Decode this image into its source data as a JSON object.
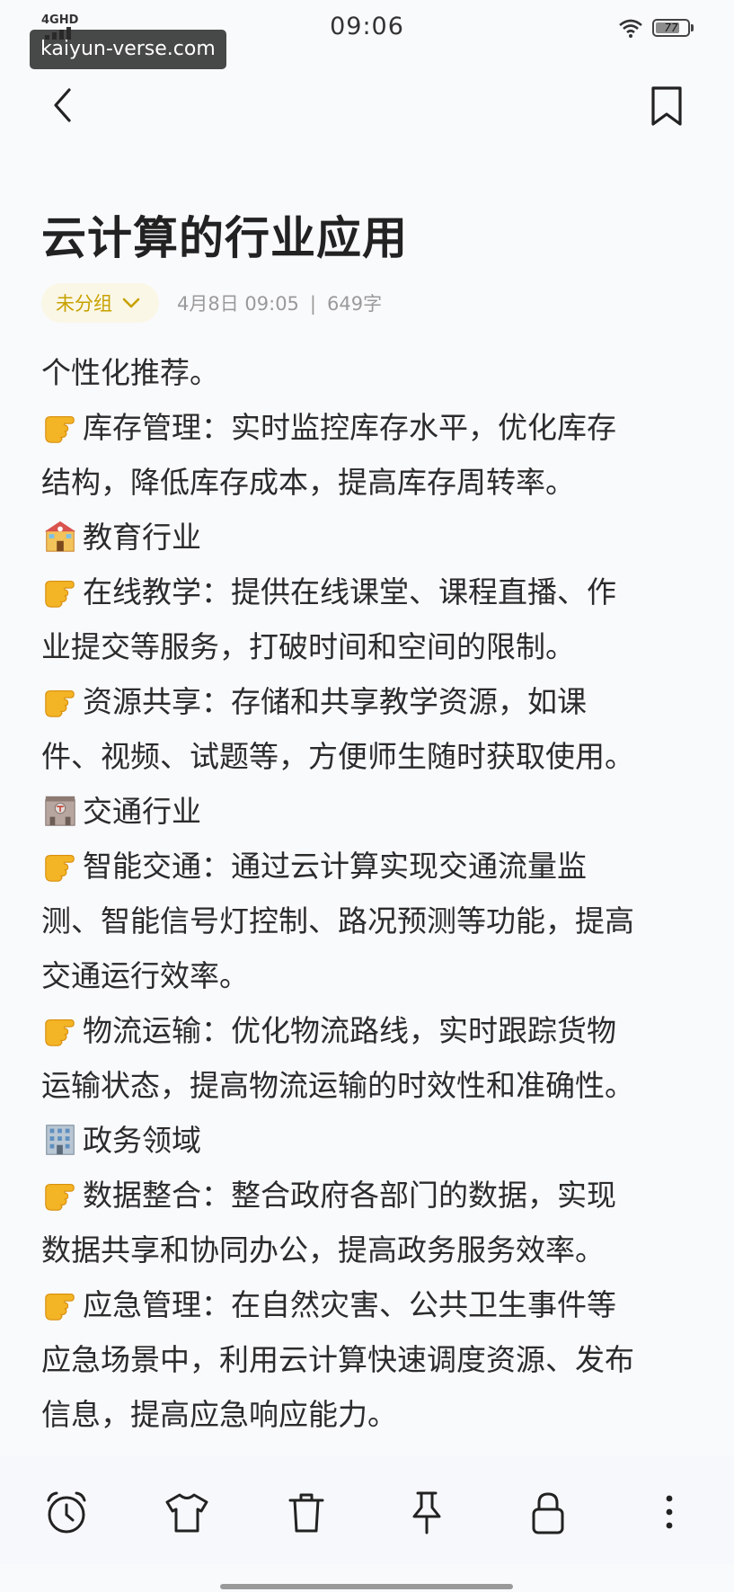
{
  "status_bar": {
    "network": "4GHD",
    "time": "09:06",
    "battery": "77",
    "battery_level": 0.77
  },
  "watermark": "kaiyun-verse.com",
  "nav": {
    "back_icon": "chevron-left-icon",
    "bookmark_icon": "bookmark-icon"
  },
  "note": {
    "title": "云计算的行业应用",
    "group": "未分组",
    "date": "4月8日 09:05",
    "separator": "|",
    "word_count": "649字"
  },
  "content": {
    "lines": [
      "个性化推荐。",
      "库存管理：实时监控库存水平，优化库存",
      "结构，降低库存成本，提高库存周转率。",
      "教育行业",
      "在线教学：提供在线课堂、课程直播、作",
      "业提交等服务，打破时间和空间的限制。",
      "资源共享：存储和共享教学资源，如课",
      "件、视频、试题等，方便师生随时获取使用。",
      "交通行业",
      "智能交通：通过云计算实现交通流量监",
      "测、智能信号灯控制、路况预测等功能，提高",
      "交通运行效率。",
      "物流运输：优化物流路线，实时跟踪货物",
      "运输状态，提高物流运输的时效性和准确性。",
      "政务领域",
      "数据整合：整合政府各部门的数据，实现",
      "数据共享和协同办公，提高政务服务效率。",
      "应急管理：在自然灾害、公共卫生事件等",
      "应急场景中，利用云计算快速调度资源、发布",
      "信息，提高应急响应能力。"
    ],
    "icons": {
      "point": "pointing-hand-icon",
      "school": "school-building-icon",
      "station": "station-building-icon",
      "office": "office-building-icon"
    }
  },
  "toolbar": {
    "items": [
      "alarm-clock-icon",
      "tshirt-icon",
      "trash-icon",
      "pin-icon",
      "lock-icon",
      "more-vertical-icon"
    ]
  },
  "colors": {
    "accent": "#c7a100",
    "pill_bg": "#fbf7e6",
    "text": "#2b2b2b",
    "meta": "#9a9a9a",
    "background": "#f9fafc"
  }
}
